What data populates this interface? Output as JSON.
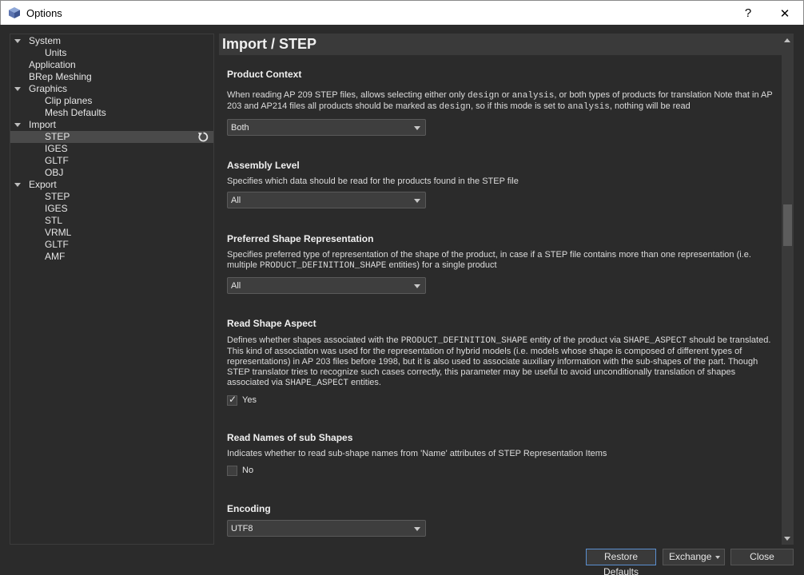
{
  "window": {
    "title": "Options",
    "help": "?",
    "close": "✕"
  },
  "tree": {
    "items": [
      {
        "label": "System",
        "expanded": true
      },
      {
        "label": "Units"
      },
      {
        "label": "Application"
      },
      {
        "label": "BRep Meshing"
      },
      {
        "label": "Graphics",
        "expanded": true
      },
      {
        "label": "Clip planes"
      },
      {
        "label": "Mesh Defaults"
      },
      {
        "label": "Import",
        "expanded": true
      },
      {
        "label": "STEP",
        "selected": true
      },
      {
        "label": "IGES"
      },
      {
        "label": "GLTF"
      },
      {
        "label": "OBJ"
      },
      {
        "label": "Export",
        "expanded": true
      },
      {
        "label": "STEP"
      },
      {
        "label": "IGES"
      },
      {
        "label": "STL"
      },
      {
        "label": "VRML"
      },
      {
        "label": "GLTF"
      },
      {
        "label": "AMF"
      }
    ]
  },
  "panel": {
    "title": "Import / STEP",
    "product_context": {
      "heading": "Product Context",
      "d1": "When reading AP 209 STEP files, allows selecting either only ",
      "c1": "design",
      "d2": " or ",
      "c2": "analysis",
      "d3": ", or both types of products for translation Note that in AP 203 and AP214 files all products should be marked as ",
      "c3": "design",
      "d4": ", so if this mode is set to ",
      "c4": "analysis",
      "d5": ", nothing will be read",
      "value": "Both"
    },
    "assembly_level": {
      "heading": "Assembly Level",
      "description": "Specifies which data should be read for the products found in the STEP file",
      "value": "All"
    },
    "preferred_shape": {
      "heading": "Preferred Shape Representation",
      "d1": "Specifies preferred type of representation of the shape of the product, in case if a STEP file contains more than one representation (i.e. multiple ",
      "c1": "PRODUCT_DEFINITION_SHAPE",
      "d2": " entities) for a single product",
      "value": "All"
    },
    "read_shape_aspect": {
      "heading": "Read Shape Aspect",
      "d1": "Defines whether shapes associated with the ",
      "c1": "PRODUCT_DEFINITION_SHAPE",
      "d2": " entity of the product via ",
      "c2": "SHAPE_ASPECT",
      "d3": " should be translated. This kind of association was used for the representation of hybrid models (i.e. models whose shape is composed of different types of representations) in AP 203 files before 1998, but it is also used to associate auxiliary information with the sub-shapes of the part. Though STEP translator tries to recognize such cases correctly, this parameter may be useful to avoid unconditionally translation of shapes associated via ",
      "c3": "SHAPE_ASPECT",
      "d4": " entities.",
      "check_label": "Yes",
      "checked": true,
      "check_mark": "✓"
    },
    "read_names": {
      "heading": "Read Names of sub Shapes",
      "description": "Indicates whether to read sub-shape names from 'Name' attributes of STEP Representation Items",
      "check_label": "No",
      "checked": false
    },
    "encoding": {
      "heading": "Encoding",
      "value": "UTF8"
    }
  },
  "buttons": {
    "restore": "Restore Defaults",
    "exchange": "Exchange",
    "close": "Close"
  }
}
